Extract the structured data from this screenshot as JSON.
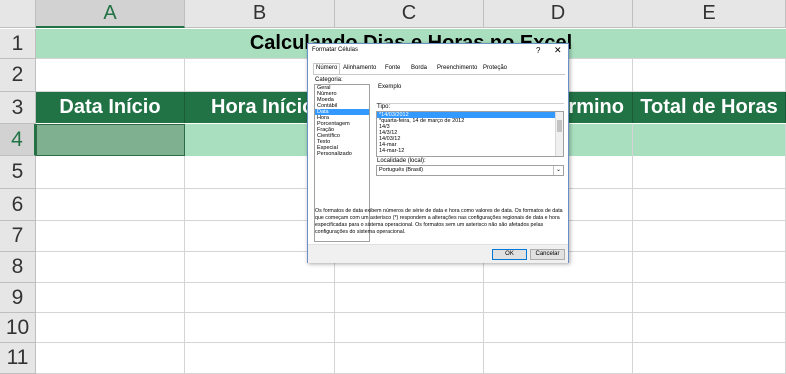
{
  "columns": [
    "A",
    "B",
    "C",
    "D",
    "E"
  ],
  "rows": [
    "1",
    "2",
    "3",
    "4",
    "5",
    "6",
    "7",
    "8",
    "9",
    "10",
    "11"
  ],
  "sheet": {
    "title": "Calculando Dias e Horas no Excel",
    "headers": [
      "Data Início",
      "Hora Início",
      "",
      "Término",
      "Total de Horas"
    ]
  },
  "dialog": {
    "title": "Formatar Células",
    "help": "?",
    "close": "✕",
    "tabs": [
      "Número",
      "Alinhamento",
      "Fonte",
      "Borda",
      "Preenchimento",
      "Proteção"
    ],
    "category_label": "Categoria:",
    "categories": [
      "Geral",
      "Número",
      "Moeda",
      "Contábil",
      "Data",
      "Hora",
      "Porcentagem",
      "Fração",
      "Científico",
      "Texto",
      "Especial",
      "Personalizado"
    ],
    "selected_category": "Data",
    "example_label": "Exemplo",
    "type_label": "Tipo:",
    "types": [
      "*14/03/2012",
      "*quarta-feira, 14 de março de 2012",
      "14/3",
      "14/3/12",
      "14/03/12",
      "14-mar",
      "14-mar-12"
    ],
    "locale_label": "Localidade (local):",
    "locale_value": "Português (Brasil)",
    "description": "Os formatos de data exibem números de série de data e hora como valores de data. Os formatos de data que começam com um asterisco (*) respondem a alterações nas configurações regionais de data e hora especificadas para o sistema operacional. Os formatos sem um asterisco não são afetados pelas configurações do sistema operacional.",
    "ok": "OK",
    "cancel": "Cancelar"
  }
}
